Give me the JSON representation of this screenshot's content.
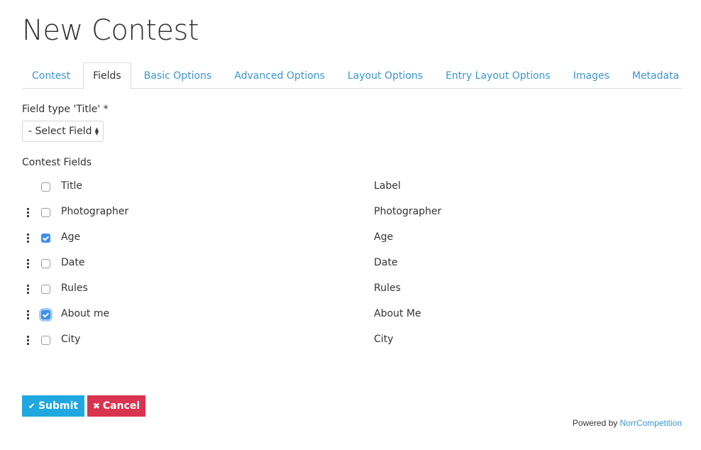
{
  "page": {
    "title": "New Contest"
  },
  "tabs": [
    {
      "label": "Contest",
      "active": false
    },
    {
      "label": "Fields",
      "active": true
    },
    {
      "label": "Basic Options",
      "active": false
    },
    {
      "label": "Advanced Options",
      "active": false
    },
    {
      "label": "Layout Options",
      "active": false
    },
    {
      "label": "Entry Layout Options",
      "active": false
    },
    {
      "label": "Images",
      "active": false
    },
    {
      "label": "Metadata",
      "active": false
    }
  ],
  "form": {
    "field_type_label": "Field type 'Title' *",
    "select": {
      "value": "- Select Field -",
      "icon": "select-arrows-icon"
    },
    "section_label": "Contest Fields",
    "header": {
      "name": "Title",
      "label": "Label",
      "checked": false
    },
    "rows": [
      {
        "name": "Photographer",
        "label": "Photographer",
        "checked": false,
        "focused": false
      },
      {
        "name": "Age",
        "label": "Age",
        "checked": true,
        "focused": false
      },
      {
        "name": "Date",
        "label": "Date",
        "checked": false,
        "focused": false
      },
      {
        "name": "Rules",
        "label": "Rules",
        "checked": false,
        "focused": false
      },
      {
        "name": "About me",
        "label": "About Me",
        "checked": true,
        "focused": true
      },
      {
        "name": "City",
        "label": "City",
        "checked": false,
        "focused": false
      }
    ]
  },
  "buttons": {
    "submit": {
      "label": "Submit",
      "icon": "check-icon",
      "color": "#1fa8e0"
    },
    "cancel": {
      "label": "Cancel",
      "icon": "times-icon",
      "color": "#d9344f"
    }
  },
  "footer": {
    "prefix": "Powered by",
    "link": "NorrCompetition"
  },
  "colors": {
    "link": "#3a96cf",
    "checkbox": "#3c8fe8"
  }
}
